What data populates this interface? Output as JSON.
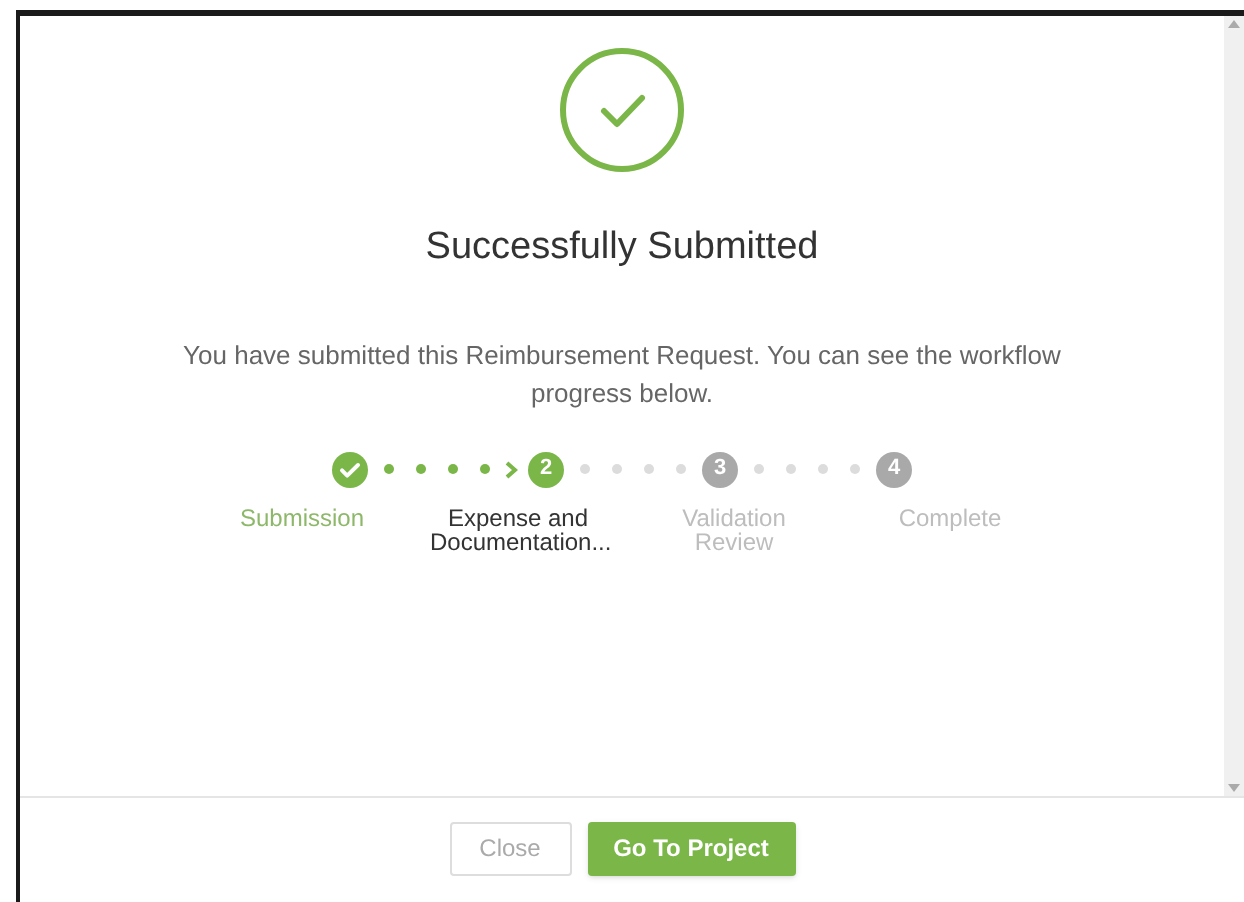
{
  "title": "Successfully Submitted",
  "message": "You have submitted this Reimbursement Request. You can see the workflow progress below.",
  "steps": [
    {
      "label": "Submission",
      "kind": "done"
    },
    {
      "number": "2",
      "label": "Expense and Documentation...",
      "kind": "current"
    },
    {
      "number": "3",
      "label": "Validation Review",
      "kind": "pending"
    },
    {
      "number": "4",
      "label": "Complete",
      "kind": "pending"
    }
  ],
  "buttons": {
    "close": "Close",
    "primary": "Go To Project"
  }
}
